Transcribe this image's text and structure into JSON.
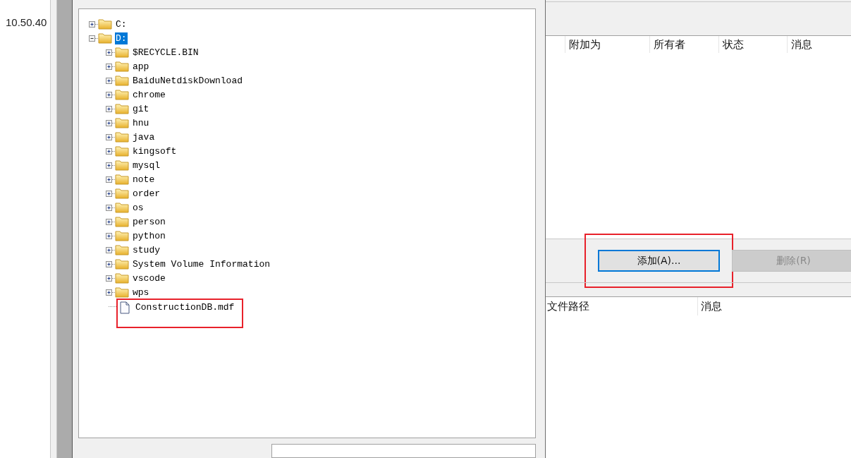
{
  "left_pane": {
    "text": "10.50.40"
  },
  "file_tree": [
    {
      "label": "C:",
      "kind": "folder",
      "expanded": false,
      "selected": false
    },
    {
      "label": "D:",
      "kind": "folder",
      "expanded": true,
      "selected": true,
      "children": [
        {
          "label": "$RECYCLE.BIN",
          "kind": "folder",
          "expanded": false,
          "selected": false
        },
        {
          "label": "app",
          "kind": "folder",
          "expanded": false,
          "selected": false
        },
        {
          "label": "BaiduNetdiskDownload",
          "kind": "folder",
          "expanded": false,
          "selected": false
        },
        {
          "label": "chrome",
          "kind": "folder",
          "expanded": false,
          "selected": false
        },
        {
          "label": "git",
          "kind": "folder",
          "expanded": false,
          "selected": false
        },
        {
          "label": "hnu",
          "kind": "folder",
          "expanded": false,
          "selected": false
        },
        {
          "label": "java",
          "kind": "folder",
          "expanded": false,
          "selected": false
        },
        {
          "label": "kingsoft",
          "kind": "folder",
          "expanded": false,
          "selected": false
        },
        {
          "label": "mysql",
          "kind": "folder",
          "expanded": false,
          "selected": false
        },
        {
          "label": "note",
          "kind": "folder",
          "expanded": false,
          "selected": false
        },
        {
          "label": "order",
          "kind": "folder",
          "expanded": false,
          "selected": false
        },
        {
          "label": "os",
          "kind": "folder",
          "expanded": false,
          "selected": false
        },
        {
          "label": "person",
          "kind": "folder",
          "expanded": false,
          "selected": false
        },
        {
          "label": "python",
          "kind": "folder",
          "expanded": false,
          "selected": false
        },
        {
          "label": "study",
          "kind": "folder",
          "expanded": false,
          "selected": false
        },
        {
          "label": "System Volume Information",
          "kind": "folder",
          "expanded": false,
          "selected": false
        },
        {
          "label": "vscode",
          "kind": "folder",
          "expanded": false,
          "selected": false
        },
        {
          "label": "wps",
          "kind": "folder",
          "expanded": false,
          "selected": false
        },
        {
          "label": "ConstructionDB.mdf",
          "kind": "file",
          "selected": false,
          "highlighted": true
        }
      ]
    }
  ],
  "databases_table": {
    "columns": [
      "附加为",
      "所有者",
      "状态",
      "消息"
    ]
  },
  "buttons": [
    {
      "label": "添加(A)...",
      "disabled": false,
      "focused": true,
      "highlighted": true
    },
    {
      "label": "删除(R)",
      "disabled": true,
      "focused": false,
      "highlighted": false
    }
  ],
  "details_table": {
    "columns": [
      "文件路径",
      "消息"
    ]
  }
}
